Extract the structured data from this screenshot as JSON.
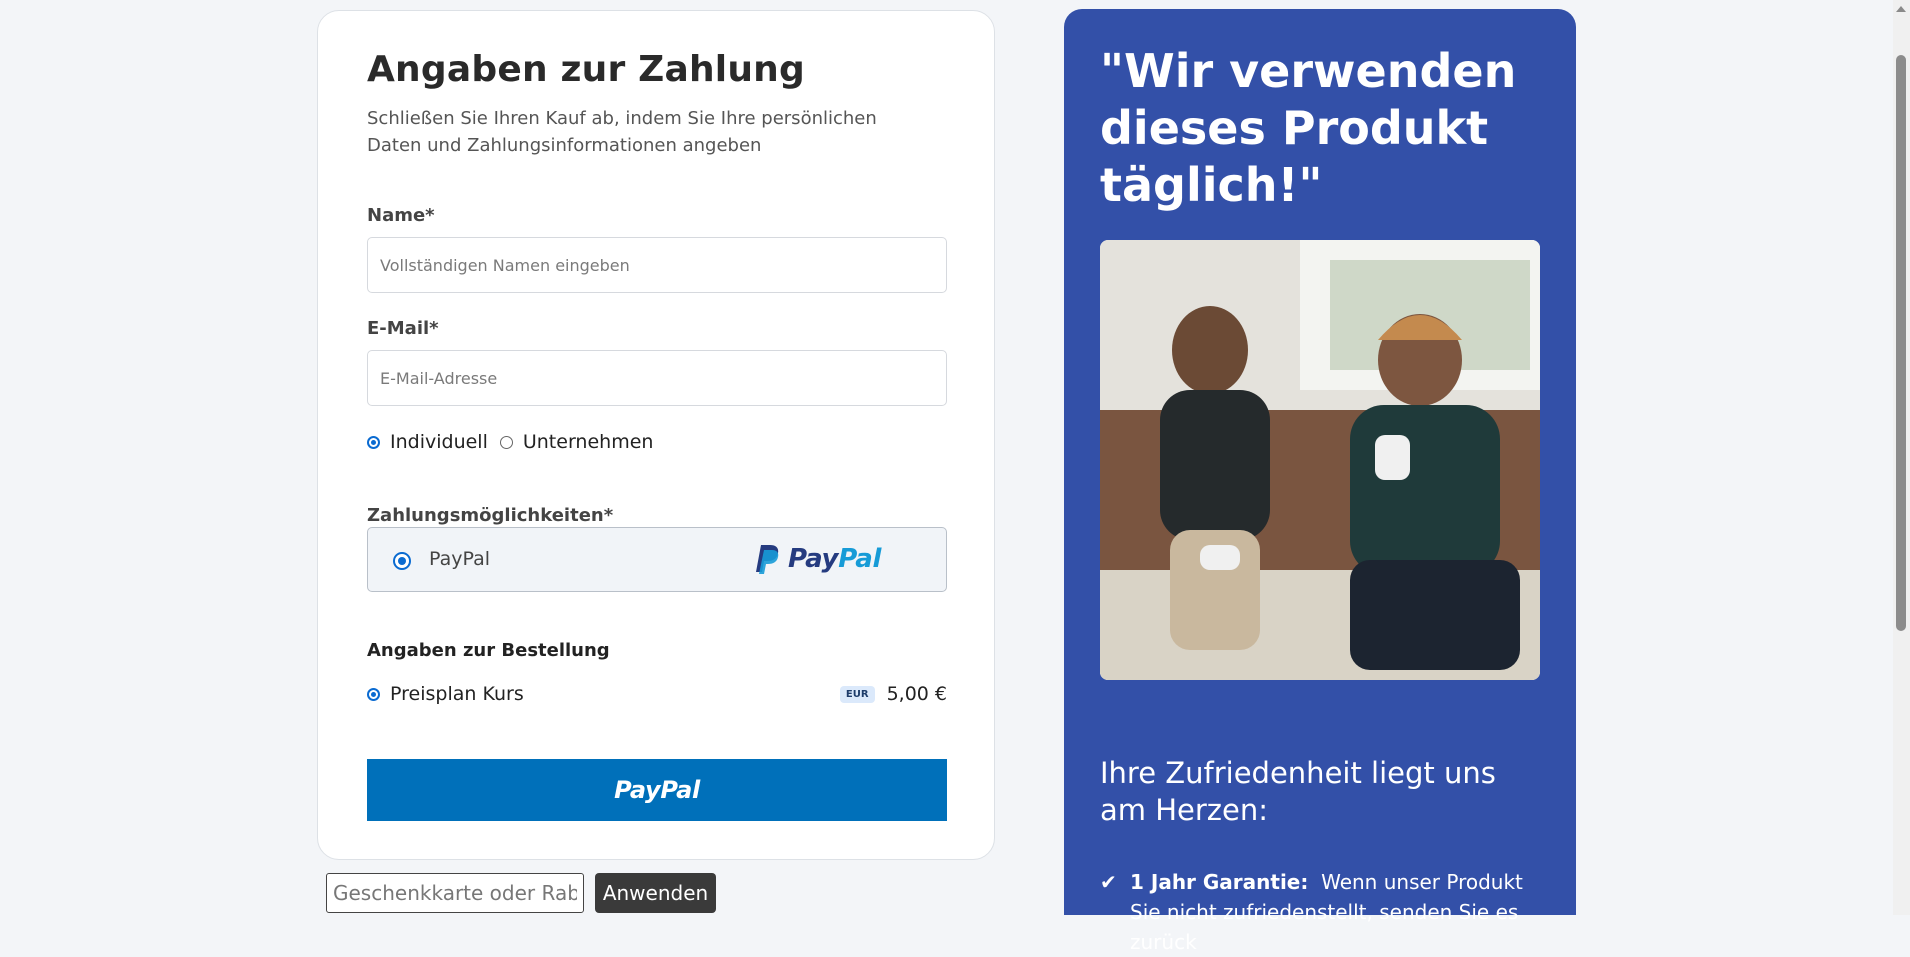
{
  "checkout": {
    "title": "Angaben zur Zahlung",
    "subtitle": "Schließen Sie Ihren Kauf ab, indem Sie Ihre persönlichen Daten und Zahlungsinformationen angeben",
    "name_label": "Name*",
    "name_placeholder": "Vollständigen Namen eingeben",
    "email_label": "E-Mail*",
    "email_placeholder": "E-Mail-Adresse",
    "customer_types": [
      {
        "label": "Individuell",
        "selected": true
      },
      {
        "label": "Unternehmen",
        "selected": false
      }
    ],
    "payment_label": "Zahlungsmöglichkeiten*",
    "payment_option": {
      "label": "PayPal",
      "logo_part1": "Pay",
      "logo_part2": "Pal",
      "selected": true
    },
    "order_title": "Angaben zur Bestellung",
    "order_item": {
      "name": "Preisplan Kurs",
      "currency_badge": "EUR",
      "price": "5,00 €",
      "selected": true
    },
    "pay_button": "PayPal",
    "gift_placeholder": "Geschenkkarte oder Rabatt",
    "apply_button": "Anwenden"
  },
  "testimonial": {
    "quote": "\"Wir verwenden dieses Produkt täglich!\"",
    "image_alt": "Zwei Männer mit Kopfhörern spielen Videospiele auf einem Sofa",
    "satisfaction_heading": "Ihre Zufriedenheit liegt uns am Herzen:",
    "guarantee_title": "1 Jahr Garantie:",
    "guarantee_text": "Wenn unser Produkt Sie nicht zufriedenstellt, senden Sie es zurück"
  },
  "colors": {
    "accent": "#0b6bd1",
    "paypal_button": "#0070ba",
    "side_panel": "#3350a8",
    "page_bg": "#f3f5f8"
  },
  "icons": {
    "check": "check-icon",
    "paypal": "paypal-logo-icon"
  }
}
